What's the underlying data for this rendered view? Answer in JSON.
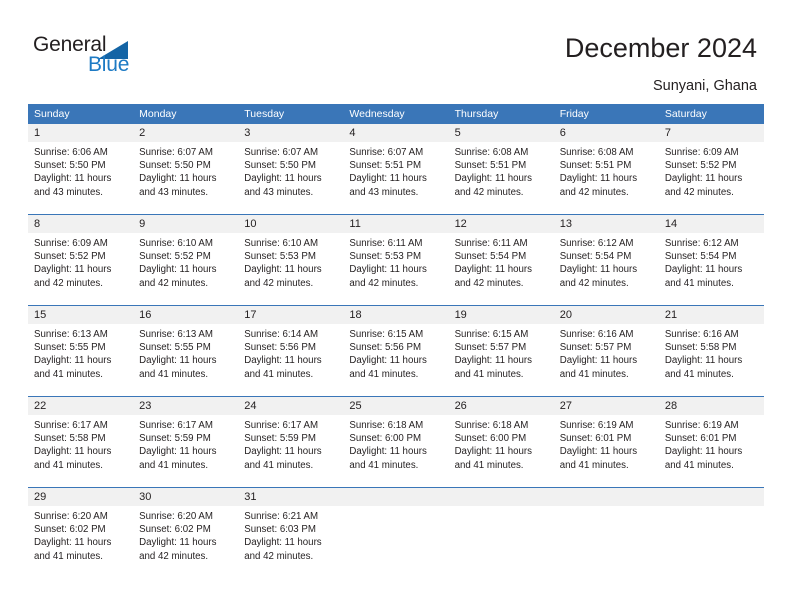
{
  "brand": {
    "name_top": "General",
    "name_bottom": "Blue",
    "triangle_color": "#1464a5",
    "blue_text_color": "#1d7ac4"
  },
  "header": {
    "title": "December 2024",
    "subtitle": "Sunyani, Ghana"
  },
  "theme": {
    "header_blue": "#3a76b8",
    "daynum_band": "#f1f1f1",
    "text": "#231f20"
  },
  "weekdays": [
    "Sunday",
    "Monday",
    "Tuesday",
    "Wednesday",
    "Thursday",
    "Friday",
    "Saturday"
  ],
  "weeks": [
    [
      {
        "day": "1",
        "lines": [
          "Sunrise: 6:06 AM",
          "Sunset: 5:50 PM",
          "Daylight: 11 hours",
          "and 43 minutes."
        ]
      },
      {
        "day": "2",
        "lines": [
          "Sunrise: 6:07 AM",
          "Sunset: 5:50 PM",
          "Daylight: 11 hours",
          "and 43 minutes."
        ]
      },
      {
        "day": "3",
        "lines": [
          "Sunrise: 6:07 AM",
          "Sunset: 5:50 PM",
          "Daylight: 11 hours",
          "and 43 minutes."
        ]
      },
      {
        "day": "4",
        "lines": [
          "Sunrise: 6:07 AM",
          "Sunset: 5:51 PM",
          "Daylight: 11 hours",
          "and 43 minutes."
        ]
      },
      {
        "day": "5",
        "lines": [
          "Sunrise: 6:08 AM",
          "Sunset: 5:51 PM",
          "Daylight: 11 hours",
          "and 42 minutes."
        ]
      },
      {
        "day": "6",
        "lines": [
          "Sunrise: 6:08 AM",
          "Sunset: 5:51 PM",
          "Daylight: 11 hours",
          "and 42 minutes."
        ]
      },
      {
        "day": "7",
        "lines": [
          "Sunrise: 6:09 AM",
          "Sunset: 5:52 PM",
          "Daylight: 11 hours",
          "and 42 minutes."
        ]
      }
    ],
    [
      {
        "day": "8",
        "lines": [
          "Sunrise: 6:09 AM",
          "Sunset: 5:52 PM",
          "Daylight: 11 hours",
          "and 42 minutes."
        ]
      },
      {
        "day": "9",
        "lines": [
          "Sunrise: 6:10 AM",
          "Sunset: 5:52 PM",
          "Daylight: 11 hours",
          "and 42 minutes."
        ]
      },
      {
        "day": "10",
        "lines": [
          "Sunrise: 6:10 AM",
          "Sunset: 5:53 PM",
          "Daylight: 11 hours",
          "and 42 minutes."
        ]
      },
      {
        "day": "11",
        "lines": [
          "Sunrise: 6:11 AM",
          "Sunset: 5:53 PM",
          "Daylight: 11 hours",
          "and 42 minutes."
        ]
      },
      {
        "day": "12",
        "lines": [
          "Sunrise: 6:11 AM",
          "Sunset: 5:54 PM",
          "Daylight: 11 hours",
          "and 42 minutes."
        ]
      },
      {
        "day": "13",
        "lines": [
          "Sunrise: 6:12 AM",
          "Sunset: 5:54 PM",
          "Daylight: 11 hours",
          "and 42 minutes."
        ]
      },
      {
        "day": "14",
        "lines": [
          "Sunrise: 6:12 AM",
          "Sunset: 5:54 PM",
          "Daylight: 11 hours",
          "and 41 minutes."
        ]
      }
    ],
    [
      {
        "day": "15",
        "lines": [
          "Sunrise: 6:13 AM",
          "Sunset: 5:55 PM",
          "Daylight: 11 hours",
          "and 41 minutes."
        ]
      },
      {
        "day": "16",
        "lines": [
          "Sunrise: 6:13 AM",
          "Sunset: 5:55 PM",
          "Daylight: 11 hours",
          "and 41 minutes."
        ]
      },
      {
        "day": "17",
        "lines": [
          "Sunrise: 6:14 AM",
          "Sunset: 5:56 PM",
          "Daylight: 11 hours",
          "and 41 minutes."
        ]
      },
      {
        "day": "18",
        "lines": [
          "Sunrise: 6:15 AM",
          "Sunset: 5:56 PM",
          "Daylight: 11 hours",
          "and 41 minutes."
        ]
      },
      {
        "day": "19",
        "lines": [
          "Sunrise: 6:15 AM",
          "Sunset: 5:57 PM",
          "Daylight: 11 hours",
          "and 41 minutes."
        ]
      },
      {
        "day": "20",
        "lines": [
          "Sunrise: 6:16 AM",
          "Sunset: 5:57 PM",
          "Daylight: 11 hours",
          "and 41 minutes."
        ]
      },
      {
        "day": "21",
        "lines": [
          "Sunrise: 6:16 AM",
          "Sunset: 5:58 PM",
          "Daylight: 11 hours",
          "and 41 minutes."
        ]
      }
    ],
    [
      {
        "day": "22",
        "lines": [
          "Sunrise: 6:17 AM",
          "Sunset: 5:58 PM",
          "Daylight: 11 hours",
          "and 41 minutes."
        ]
      },
      {
        "day": "23",
        "lines": [
          "Sunrise: 6:17 AM",
          "Sunset: 5:59 PM",
          "Daylight: 11 hours",
          "and 41 minutes."
        ]
      },
      {
        "day": "24",
        "lines": [
          "Sunrise: 6:17 AM",
          "Sunset: 5:59 PM",
          "Daylight: 11 hours",
          "and 41 minutes."
        ]
      },
      {
        "day": "25",
        "lines": [
          "Sunrise: 6:18 AM",
          "Sunset: 6:00 PM",
          "Daylight: 11 hours",
          "and 41 minutes."
        ]
      },
      {
        "day": "26",
        "lines": [
          "Sunrise: 6:18 AM",
          "Sunset: 6:00 PM",
          "Daylight: 11 hours",
          "and 41 minutes."
        ]
      },
      {
        "day": "27",
        "lines": [
          "Sunrise: 6:19 AM",
          "Sunset: 6:01 PM",
          "Daylight: 11 hours",
          "and 41 minutes."
        ]
      },
      {
        "day": "28",
        "lines": [
          "Sunrise: 6:19 AM",
          "Sunset: 6:01 PM",
          "Daylight: 11 hours",
          "and 41 minutes."
        ]
      }
    ],
    [
      {
        "day": "29",
        "lines": [
          "Sunrise: 6:20 AM",
          "Sunset: 6:02 PM",
          "Daylight: 11 hours",
          "and 41 minutes."
        ]
      },
      {
        "day": "30",
        "lines": [
          "Sunrise: 6:20 AM",
          "Sunset: 6:02 PM",
          "Daylight: 11 hours",
          "and 42 minutes."
        ]
      },
      {
        "day": "31",
        "lines": [
          "Sunrise: 6:21 AM",
          "Sunset: 6:03 PM",
          "Daylight: 11 hours",
          "and 42 minutes."
        ]
      },
      {
        "day": "",
        "lines": []
      },
      {
        "day": "",
        "lines": []
      },
      {
        "day": "",
        "lines": []
      },
      {
        "day": "",
        "lines": []
      }
    ]
  ]
}
